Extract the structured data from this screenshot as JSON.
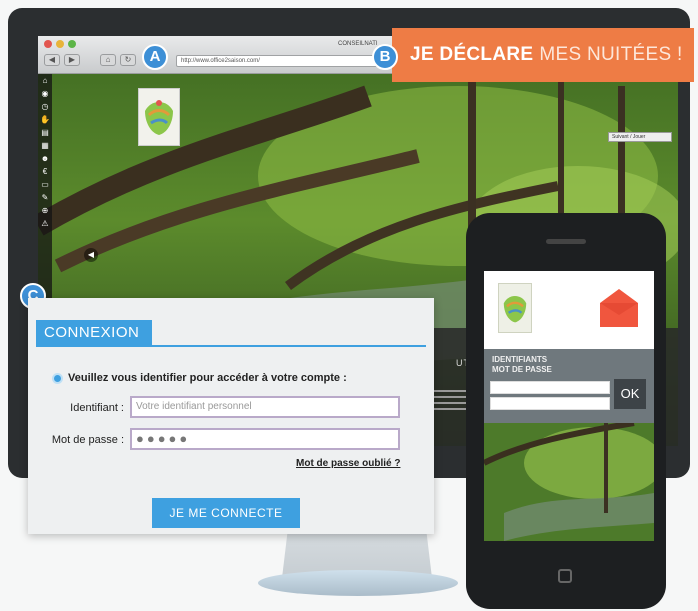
{
  "browser": {
    "url": "http://www.office2saison.com/",
    "tab_title": "CONSEILNATI",
    "nav_buttons": [
      "◀",
      "▶",
      "⌂",
      "↻"
    ],
    "subscribe_label": "Suivant / Jouer",
    "side_icons": [
      "home-icon",
      "eye-icon",
      "clock-icon",
      "thumbs-up-icon",
      "document-icon",
      "calendar-icon",
      "user-icon",
      "euro-icon",
      "printer-icon",
      "wrench-icon",
      "network-icon",
      "warning-icon"
    ]
  },
  "markers": {
    "a": "A",
    "b": "B",
    "c": "C"
  },
  "banner": {
    "strong": "JE DÉCLARE",
    "light": "MES NUITÉES !"
  },
  "desktop_panel": {
    "heading": "UTÉ DE"
  },
  "login": {
    "title": "CONNEXION",
    "intro": "Veuillez vous identifier pour accéder à votre compte :",
    "identifiant_label": "Identifiant :",
    "identifiant_placeholder": "Votre identifiant personnel",
    "password_label": "Mot de passe :",
    "password_value": "●●●●●",
    "forgot_link": "Mot de passe oublié ?",
    "submit": "JE ME CONNECTE"
  },
  "mobile": {
    "identifiant_label": "IDENTIFIANTS",
    "password_label": "MOT DE PASSE",
    "ok_button": "OK"
  },
  "colors": {
    "accent_blue": "#3ea0e0",
    "banner_orange": "#ee7c45",
    "marker_blue": "#3d8fd6"
  }
}
